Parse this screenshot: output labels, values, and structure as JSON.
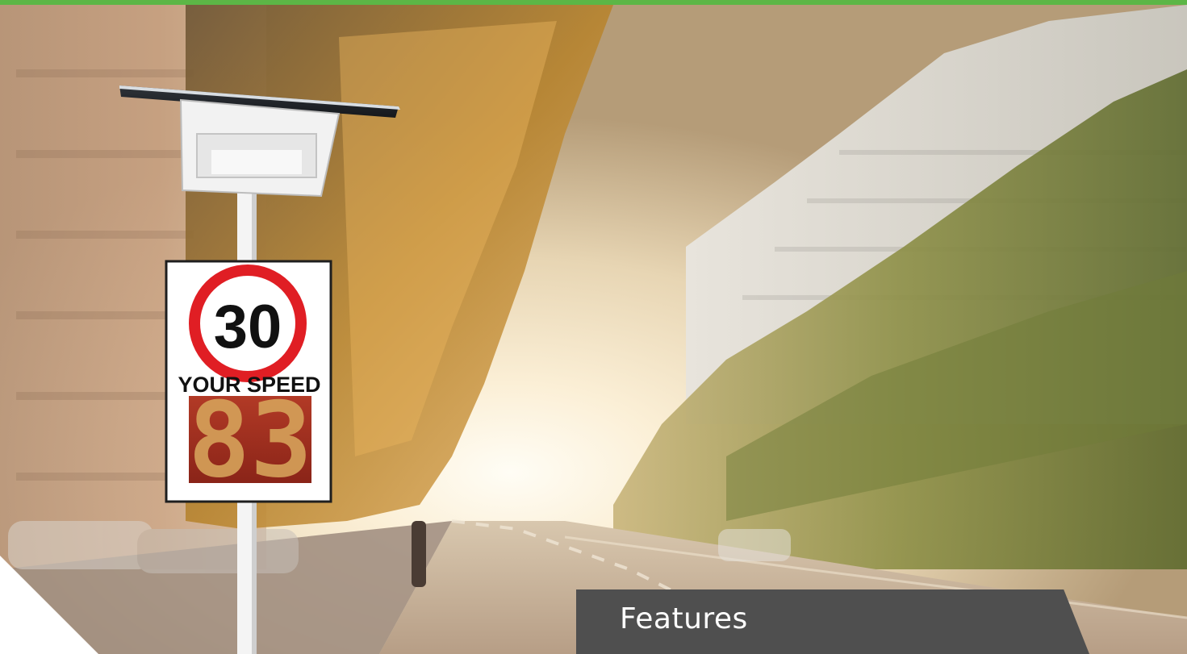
{
  "colors": {
    "top_bar": "#5cb646",
    "features_tab": "#4f4f4f",
    "sign_ring": "#e01e24",
    "led_digits": "#d6a25a",
    "led_panel": "#9e2a1c"
  },
  "sign": {
    "speed_limit": "30",
    "caption": "YOUR SPEED",
    "display_value": "83"
  },
  "features": {
    "title": "Features"
  }
}
